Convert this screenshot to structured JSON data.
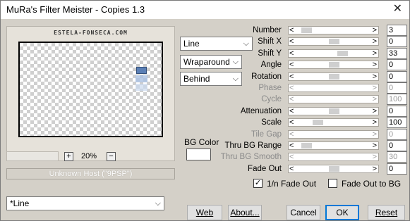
{
  "window": {
    "title": "MuRa's Filter Meister - Copies 1.3",
    "close_glyph": "✕"
  },
  "preview": {
    "watermark": "ESTELA-FONSECA.COM"
  },
  "zoom": {
    "plus": "+",
    "minus": "−",
    "value": "20%"
  },
  "host_status": "Unknown Host (\"9PSP\")",
  "dropdowns": {
    "mode": "Line",
    "wrap": "Wraparound",
    "order": "Behind",
    "preset": "*Line",
    "chevron": "⌵"
  },
  "bg_color": {
    "label": "BG Color",
    "value": "#ffffff"
  },
  "params": [
    {
      "label": "Number",
      "value": "3",
      "level": 0.08,
      "enabled": true
    },
    {
      "label": "Shift X",
      "value": "0",
      "level": 0.5,
      "enabled": true
    },
    {
      "label": "Shift Y",
      "value": "33",
      "level": 0.63,
      "enabled": true
    },
    {
      "label": "Angle",
      "value": "0",
      "level": 0.5,
      "enabled": true
    },
    {
      "label": "Rotation",
      "value": "0",
      "level": 0.5,
      "enabled": true
    },
    {
      "label": "Phase",
      "value": "0",
      "level": null,
      "enabled": false
    },
    {
      "label": "Cycle",
      "value": "100",
      "level": null,
      "enabled": false
    },
    {
      "label": "Attenuation",
      "value": "0",
      "level": 0.5,
      "enabled": true
    },
    {
      "label": "Scale",
      "value": "100",
      "level": 0.26,
      "enabled": true
    },
    {
      "label": "Tile Gap",
      "value": "0",
      "level": null,
      "enabled": false
    },
    {
      "label": "Thru BG Range",
      "value": "0",
      "level": 0.08,
      "enabled": true
    },
    {
      "label": "Thru BG Smooth",
      "value": "30",
      "level": null,
      "enabled": false
    },
    {
      "label": "Fade Out",
      "value": "0",
      "level": 0.5,
      "enabled": true
    }
  ],
  "arrows": {
    "left": "<",
    "right": ">"
  },
  "checkboxes": {
    "fade_1n": {
      "label": "1/n Fade Out",
      "checked": true,
      "mark": "✓"
    },
    "fade_bg": {
      "label": "Fade Out to BG",
      "checked": false,
      "mark": ""
    }
  },
  "buttons": {
    "web": "Web",
    "about": "About...",
    "cancel": "Cancel",
    "ok": "OK",
    "reset": "Reset"
  }
}
